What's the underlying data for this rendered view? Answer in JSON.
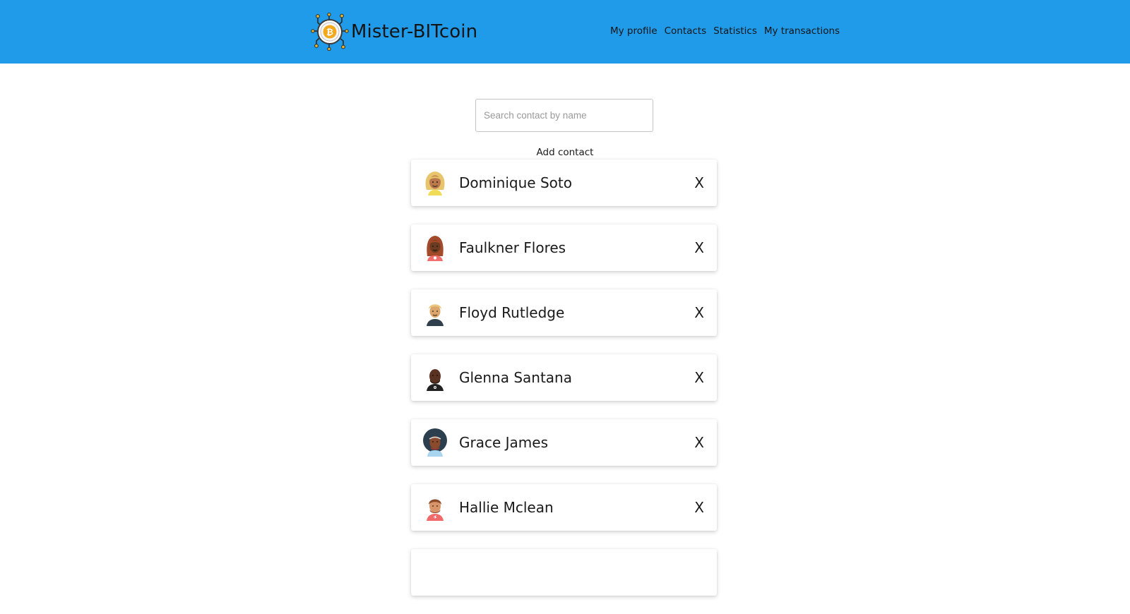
{
  "header": {
    "brand_name": "Mister-BITcoin",
    "logo_icon": "bitcoin-circuit-logo-icon",
    "background_color": "#1f9bea",
    "nav": [
      {
        "label": "My profile"
      },
      {
        "label": "Contacts"
      },
      {
        "label": "Statistics"
      },
      {
        "label": "My transactions"
      }
    ]
  },
  "search": {
    "placeholder": "Search contact by name",
    "value": ""
  },
  "add_contact_label": "Add contact",
  "contacts": [
    {
      "name": "Dominique Soto",
      "delete_label": "X",
      "avatar_icon": "avatar-blonde-long-hair-icon"
    },
    {
      "name": "Faulkner Flores",
      "delete_label": "X",
      "avatar_icon": "avatar-red-long-hair-icon"
    },
    {
      "name": "Floyd Rutledge",
      "delete_label": "X",
      "avatar_icon": "avatar-blonde-short-hair-icon"
    },
    {
      "name": "Glenna Santana",
      "delete_label": "X",
      "avatar_icon": "avatar-bald-beard-icon"
    },
    {
      "name": "Grace James",
      "delete_label": "X",
      "avatar_icon": "avatar-afro-hair-icon"
    },
    {
      "name": "Hallie Mclean",
      "delete_label": "X",
      "avatar_icon": "avatar-brown-hair-beard-icon"
    }
  ]
}
